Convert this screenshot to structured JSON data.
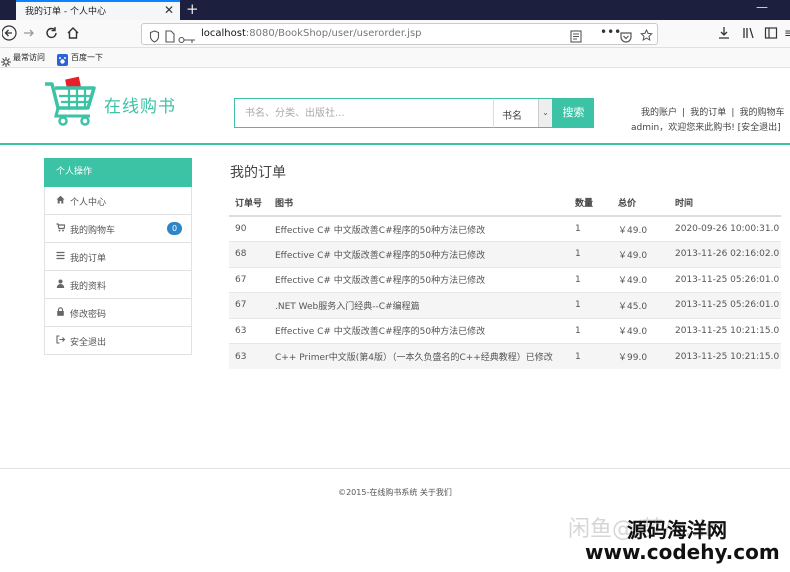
{
  "browser": {
    "tab_title": "我的订单 - 个人中心",
    "tab_close": "✕",
    "new_tab": "+",
    "window_min": "—",
    "url_host": "localhost",
    "url_rest": ":8080/BookShop/user/userorder.jsp",
    "bookmarks": [
      "最常访问",
      "百度一下"
    ]
  },
  "header": {
    "logo_text": "在线购书",
    "search_placeholder": "书名、分类、出版社...",
    "search_select_value": "书名",
    "search_button": "搜索",
    "links": [
      "我的账户",
      "我的订单",
      "我的购物车"
    ],
    "separator": "|",
    "welcome": "admin，欢迎您来此购书! ",
    "logout_link": "[安全退出]",
    "accent_color": "#3cc3a5"
  },
  "sidebar": {
    "heading": "个人操作",
    "items": [
      {
        "label": "个人中心",
        "icon": "home-icon"
      },
      {
        "label": "我的购物车",
        "icon": "cart-icon",
        "badge": "0"
      },
      {
        "label": "我的订单",
        "icon": "list-icon"
      },
      {
        "label": "我的资料",
        "icon": "user-icon"
      },
      {
        "label": "修改密码",
        "icon": "lock-icon"
      },
      {
        "label": "安全退出",
        "icon": "sign-out-icon"
      }
    ]
  },
  "main": {
    "title": "我的订单",
    "columns": [
      "订单号",
      "图书",
      "数量",
      "总价",
      "时间"
    ],
    "rows": [
      [
        "90",
        "Effective C# 中文版改善C#程序的50种方法已修改",
        "1",
        "￥49.0",
        "2020-09-26 10:00:31.0"
      ],
      [
        "68",
        "Effective C# 中文版改善C#程序的50种方法已修改",
        "1",
        "￥49.0",
        "2013-11-26 02:16:02.0"
      ],
      [
        "67",
        "Effective C# 中文版改善C#程序的50种方法已修改",
        "1",
        "￥49.0",
        "2013-11-25 05:26:01.0"
      ],
      [
        "67",
        ".NET Web服务入门经典--C#编程篇",
        "1",
        "￥45.0",
        "2013-11-25 05:26:01.0"
      ],
      [
        "63",
        "Effective C# 中文版改善C#程序的50种方法已修改",
        "1",
        "￥49.0",
        "2013-11-25 10:21:15.0"
      ],
      [
        "63",
        "C++ Primer中文版(第4版）（一本久负盛名的C++经典教程）已修改",
        "1",
        "￥99.0",
        "2013-11-25 10:21:15.0"
      ]
    ]
  },
  "footer": {
    "text": "©2015-在线购书系统 关于我们"
  },
  "watermark": {
    "faint": "闲鱼@/梦/ ...lr",
    "brand": "源码海洋网",
    "site": "www.codehy.com"
  }
}
